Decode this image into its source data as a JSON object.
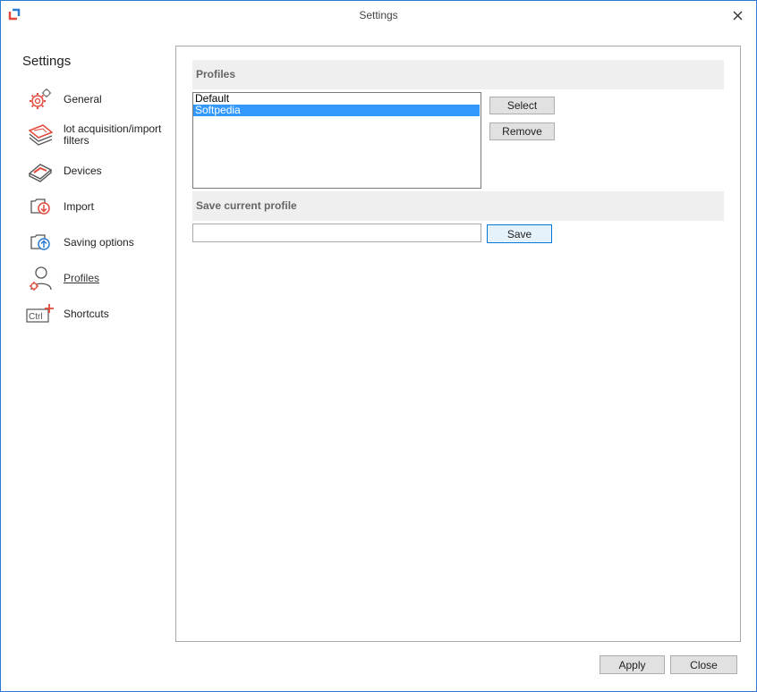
{
  "window": {
    "title": "Settings"
  },
  "sidebar": {
    "title": "Settings",
    "items": [
      {
        "label": "General",
        "icon": "gear-icon"
      },
      {
        "label": "lot acquisition/import filters",
        "icon": "filter-stack-icon"
      },
      {
        "label": "Devices",
        "icon": "scanner-icon"
      },
      {
        "label": "Import",
        "icon": "import-icon"
      },
      {
        "label": "Saving options",
        "icon": "save-options-icon"
      },
      {
        "label": "Profiles",
        "icon": "profile-icon",
        "active": true
      },
      {
        "label": "Shortcuts",
        "icon": "ctrl-shortcut-icon"
      }
    ]
  },
  "profiles": {
    "header": "Profiles",
    "list": [
      "Default",
      "Softpedia"
    ],
    "selected": "Softpedia",
    "select_label": "Select",
    "remove_label": "Remove"
  },
  "save_profile": {
    "header": "Save current profile",
    "value": "",
    "save_label": "Save"
  },
  "footer": {
    "apply_label": "Apply",
    "close_label": "Close"
  },
  "colors": {
    "accent": "#e3483c",
    "selection": "#3399ff",
    "border": "#2b7bd3"
  }
}
